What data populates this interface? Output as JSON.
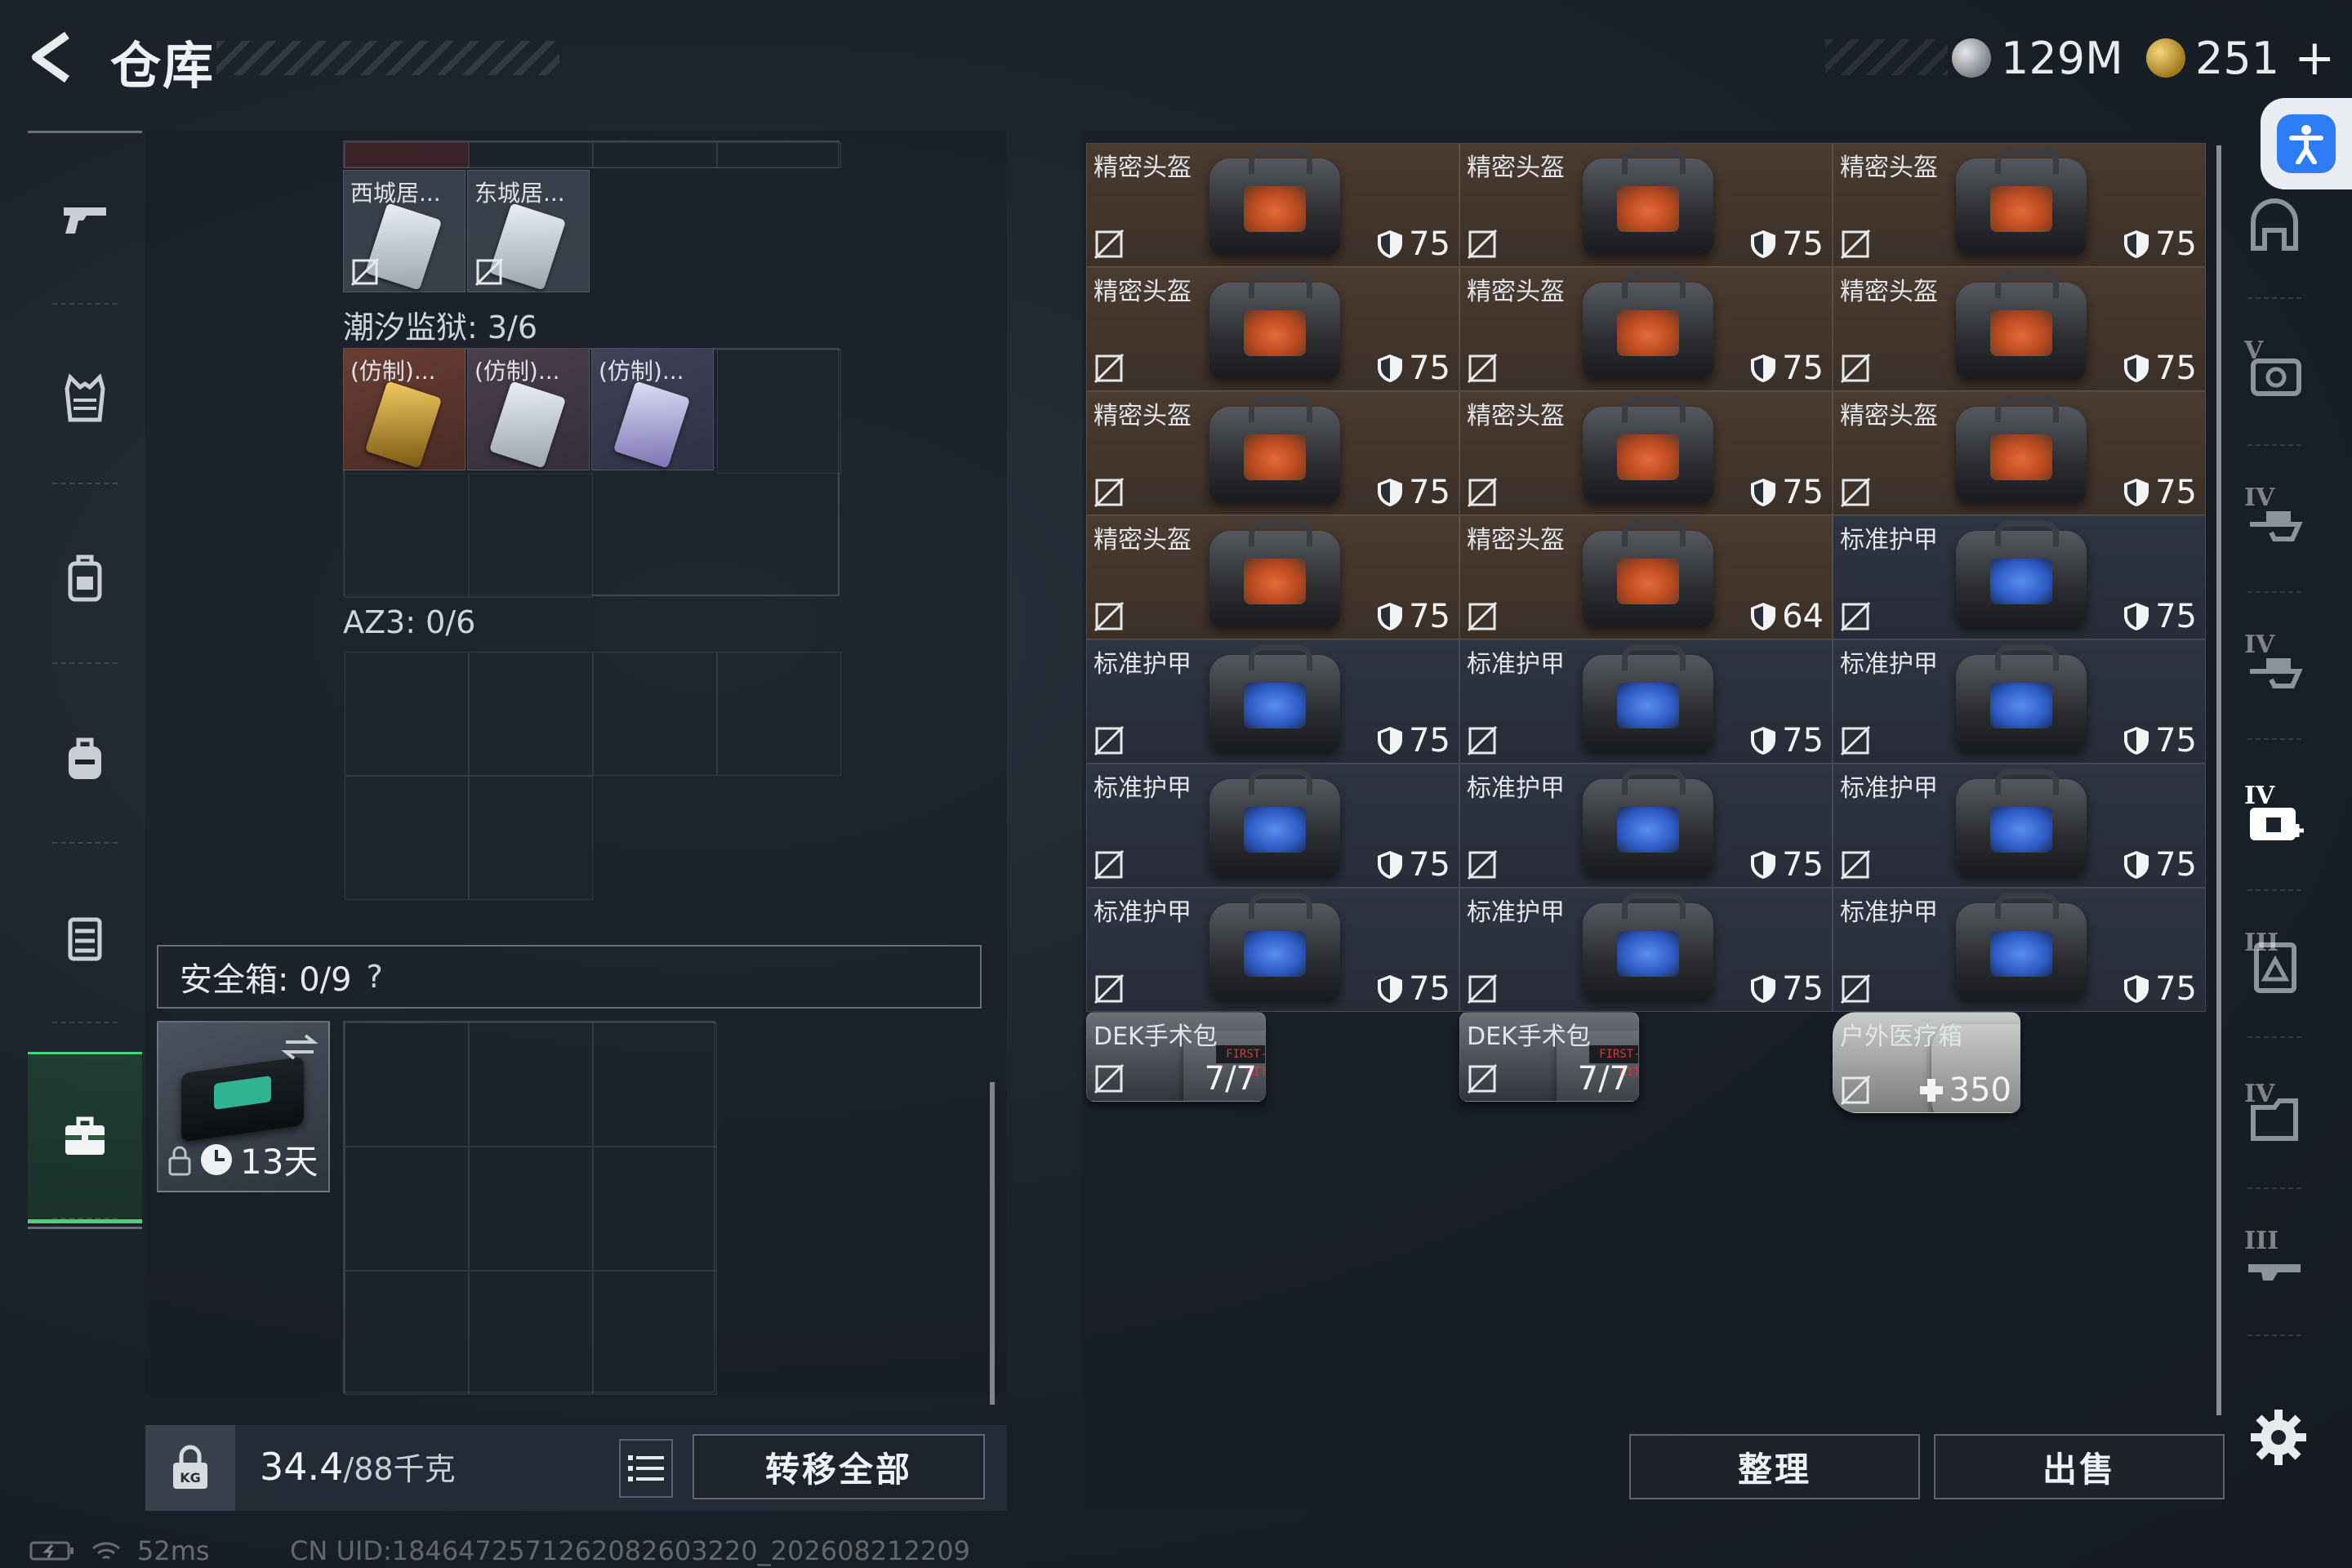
{
  "header": {
    "title": "仓库",
    "currency_silver": "129M",
    "currency_gold": "251"
  },
  "left_nav": [
    "weapon-icon",
    "vest-icon",
    "armor-icon",
    "backpack-icon",
    "chest-rig-icon",
    "safebox-icon"
  ],
  "left_panel": {
    "top_keys": [
      {
        "name": "西城居..."
      },
      {
        "name": "东城居..."
      }
    ],
    "group1": {
      "label": "潮汐监狱: 3/6",
      "keys": [
        {
          "name": "(仿制)..."
        },
        {
          "name": "(仿制)..."
        },
        {
          "name": "(仿制)..."
        }
      ]
    },
    "group2": {
      "label": "AZ3: 0/6"
    },
    "safe": {
      "label": "安全箱: 0/9",
      "help": "?",
      "timer": "13天"
    },
    "weight": {
      "value": "34.4",
      "unit": "/88千克"
    },
    "transfer_all": "转移全部"
  },
  "items": [
    {
      "type": "helmet",
      "name": "精密头盔",
      "value": "75"
    },
    {
      "type": "helmet",
      "name": "精密头盔",
      "value": "75"
    },
    {
      "type": "helmet",
      "name": "精密头盔",
      "value": "75"
    },
    {
      "type": "helmet",
      "name": "精密头盔",
      "value": "75"
    },
    {
      "type": "helmet",
      "name": "精密头盔",
      "value": "75"
    },
    {
      "type": "helmet",
      "name": "精密头盔",
      "value": "75"
    },
    {
      "type": "helmet",
      "name": "精密头盔",
      "value": "75"
    },
    {
      "type": "helmet",
      "name": "精密头盔",
      "value": "75"
    },
    {
      "type": "helmet",
      "name": "精密头盔",
      "value": "75"
    },
    {
      "type": "helmet",
      "name": "精密头盔",
      "value": "75"
    },
    {
      "type": "helmet",
      "name": "精密头盔",
      "value": "64"
    },
    {
      "type": "armor",
      "name": "标准护甲",
      "value": "75"
    },
    {
      "type": "armor",
      "name": "标准护甲",
      "value": "75"
    },
    {
      "type": "armor",
      "name": "标准护甲",
      "value": "75"
    },
    {
      "type": "armor",
      "name": "标准护甲",
      "value": "75"
    },
    {
      "type": "armor",
      "name": "标准护甲",
      "value": "75"
    },
    {
      "type": "armor",
      "name": "标准护甲",
      "value": "75"
    },
    {
      "type": "armor",
      "name": "标准护甲",
      "value": "75"
    },
    {
      "type": "armor",
      "name": "标准护甲",
      "value": "75"
    },
    {
      "type": "armor",
      "name": "标准护甲",
      "value": "75"
    },
    {
      "type": "armor",
      "name": "标准护甲",
      "value": "75"
    },
    {
      "type": "medkit",
      "name": "DEK手术包",
      "value": "7/7"
    },
    {
      "type": "medkit",
      "name": "DEK手术包",
      "value": "7/7"
    },
    {
      "type": "medbag",
      "name": "户外医疗箱",
      "value": "350"
    }
  ],
  "actions": {
    "sort": "整理",
    "sell": "出售"
  },
  "filters": [
    {
      "icon": "helmet-filter-icon",
      "tier": ""
    },
    {
      "icon": "armor-v-filter-icon",
      "tier": "V"
    },
    {
      "icon": "armor-iv-filter-icon",
      "tier": "IV"
    },
    {
      "icon": "rig-iv-filter-icon",
      "tier": "IV"
    },
    {
      "icon": "medkit-iv-filter-icon",
      "tier": "IV"
    },
    {
      "icon": "helmet-iii-filter-icon",
      "tier": "III"
    },
    {
      "icon": "bag-iv-filter-icon",
      "tier": "IV"
    },
    {
      "icon": "weapon-iii-filter-icon",
      "tier": "III"
    }
  ],
  "status": {
    "ping": "52ms",
    "uid": "CN UID:1846472571262082603220_202608212209"
  }
}
